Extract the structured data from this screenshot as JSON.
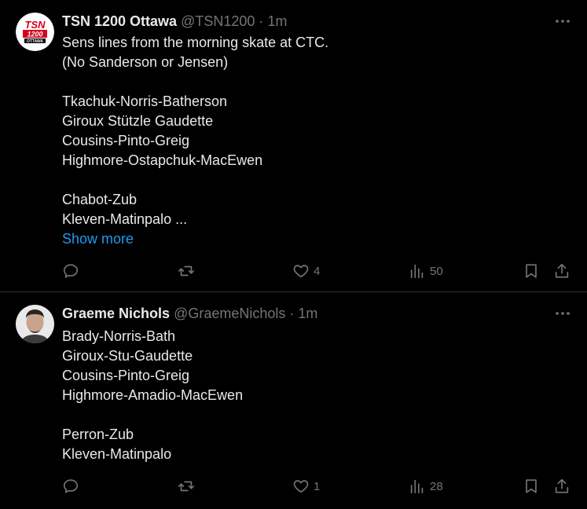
{
  "tweets": [
    {
      "author_name": "TSN 1200 Ottawa",
      "handle": "@TSN1200",
      "separator": "·",
      "time": "1m",
      "avatar_text": [
        "TSN",
        "1200",
        "OTTAWA"
      ],
      "lines": [
        "Sens lines from the morning skate at CTC.",
        "(No Sanderson or Jensen)",
        "",
        "Tkachuk-Norris-Batherson",
        "Giroux Stützle Gaudette",
        "Cousins-Pinto-Greig",
        "Highmore-Ostapchuk-MacEwen",
        "",
        "Chabot-Zub",
        "Kleven-Matinpalo ..."
      ],
      "show_more": "Show more",
      "replies": "",
      "reposts": "",
      "likes": "4",
      "views": "50",
      "icons": [
        "reply-icon",
        "repost-icon",
        "like-icon",
        "views-icon",
        "bookmark-icon",
        "share-icon",
        "more-icon"
      ]
    },
    {
      "author_name": "Graeme Nichols",
      "handle": "@GraemeNichols",
      "separator": "·",
      "time": "1m",
      "lines": [
        "Brady-Norris-Bath",
        "Giroux-Stu-Gaudette",
        "Cousins-Pinto-Greig",
        "Highmore-Amadio-MacEwen",
        "",
        "Perron-Zub",
        "Kleven-Matinpalo"
      ],
      "replies": "",
      "reposts": "",
      "likes": "1",
      "views": "28",
      "icons": [
        "reply-icon",
        "repost-icon",
        "like-icon",
        "views-icon",
        "bookmark-icon",
        "share-icon",
        "more-icon"
      ]
    }
  ],
  "colors": {
    "background": "#000000",
    "text": "#e7e9ea",
    "muted": "#71767b",
    "link": "#1d9bf0",
    "divider": "#2f3336"
  }
}
